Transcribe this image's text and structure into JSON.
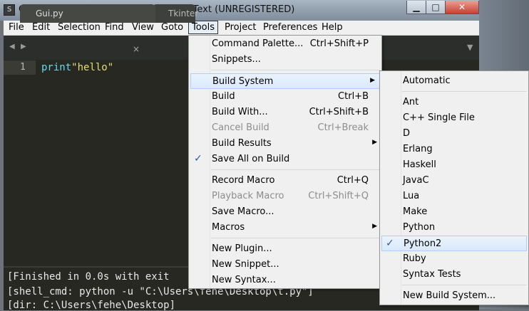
{
  "window": {
    "title": "C:\\Users\\fehe\\Desktop\\t.py - Sublime Text (UNREGISTERED)",
    "minimize_glyph": "▁",
    "maximize_glyph": "□",
    "close_glyph": "✕"
  },
  "menubar": [
    "File",
    "Edit",
    "Selection",
    "Find",
    "View",
    "Goto",
    "Tools",
    "Project",
    "Preferences",
    "Help"
  ],
  "tabs": {
    "items": [
      "Gui.py",
      "Tkinter"
    ],
    "close_glyph": "×",
    "nav_left": "◀",
    "nav_right": "▶",
    "dropdown": "▼"
  },
  "editor": {
    "line_number": "1",
    "code_fn": "print",
    "code_str": "\"hello\""
  },
  "output": [
    "[Finished in 0.0s with exit",
    "[shell_cmd: python -u \"C:\\Users\\fehe\\Desktop\\t.py\"]",
    "[dir: C:\\Users\\fehe\\Desktop]"
  ],
  "tools_menu": [
    {
      "label": "Command Palette...",
      "shortcut": "Ctrl+Shift+P"
    },
    {
      "label": "Snippets...",
      "shortcut": ""
    },
    {
      "label": "Build System",
      "shortcut": "",
      "submenu": true
    },
    {
      "label": "Build",
      "shortcut": "Ctrl+B"
    },
    {
      "label": "Build With...",
      "shortcut": "Ctrl+Shift+B"
    },
    {
      "label": "Cancel Build",
      "shortcut": "Ctrl+Break",
      "disabled": true
    },
    {
      "label": "Build Results",
      "shortcut": "",
      "submenu": true
    },
    {
      "label": "Save All on Build",
      "shortcut": "",
      "checked": true
    },
    {
      "label": "Record Macro",
      "shortcut": "Ctrl+Q"
    },
    {
      "label": "Playback Macro",
      "shortcut": "Ctrl+Shift+Q",
      "disabled": true
    },
    {
      "label": "Save Macro...",
      "shortcut": ""
    },
    {
      "label": "Macros",
      "shortcut": "",
      "submenu": true
    },
    {
      "label": "New Plugin...",
      "shortcut": ""
    },
    {
      "label": "New Snippet...",
      "shortcut": ""
    },
    {
      "label": "New Syntax...",
      "shortcut": ""
    }
  ],
  "build_menu": [
    {
      "label": "Automatic"
    },
    {
      "label": "Ant"
    },
    {
      "label": "C++ Single File"
    },
    {
      "label": "D"
    },
    {
      "label": "Erlang"
    },
    {
      "label": "Haskell"
    },
    {
      "label": "JavaC"
    },
    {
      "label": "Lua"
    },
    {
      "label": "Make"
    },
    {
      "label": "Python"
    },
    {
      "label": "Python2",
      "checked": true
    },
    {
      "label": "Ruby"
    },
    {
      "label": "Syntax Tests"
    },
    {
      "label": "New Build System..."
    }
  ],
  "glyphs": {
    "check": "✓",
    "submenu_arrow": "▶"
  },
  "colors": {
    "keyword": "#66d9ef",
    "string": "#e6db74",
    "editor_bg": "#272822"
  }
}
